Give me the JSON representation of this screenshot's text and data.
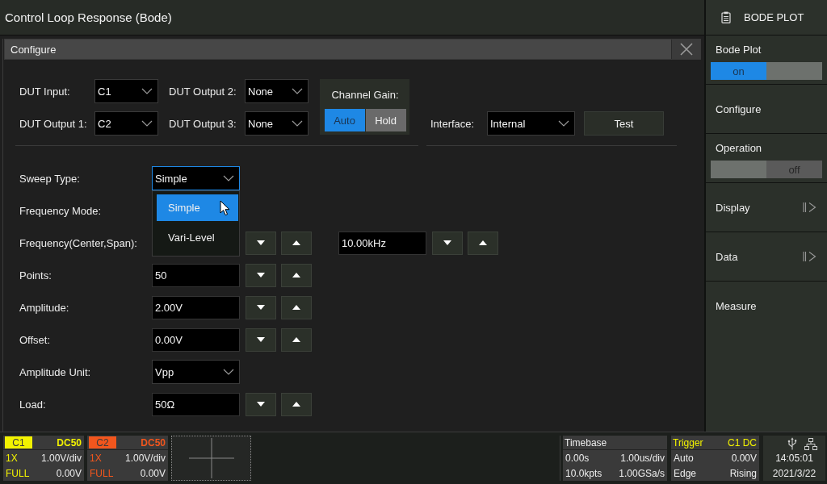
{
  "title_bar": {
    "title": "Control Loop Response (Bode)"
  },
  "menu_header": {
    "title": "BODE PLOT"
  },
  "dialog": {
    "title": "Configure",
    "dut": [
      {
        "label": "DUT Input:",
        "value": "C1"
      },
      {
        "label": "DUT Output 2:",
        "value": "None"
      },
      {
        "label": "DUT Output 1:",
        "value": "C2"
      },
      {
        "label": "DUT Output 3:",
        "value": "None"
      }
    ],
    "channel_gain": {
      "label": "Channel Gain:",
      "options": [
        {
          "label": "Auto",
          "selected": true
        },
        {
          "label": "Hold",
          "selected": false
        }
      ]
    },
    "interface": {
      "label": "Interface:",
      "value": "Internal"
    },
    "test_button": "Test",
    "settings": [
      {
        "label": "Sweep Type:",
        "kind": "select",
        "value": "Simple",
        "focused": true,
        "options": [
          {
            "label": "Simple",
            "selected": true
          },
          {
            "label": "Vari-Level",
            "selected": false
          }
        ]
      },
      {
        "label": "Frequency Mode:",
        "kind": "label"
      },
      {
        "label": "Frequency(Center,Span):",
        "kind": "span",
        "fields": [
          {
            "value": "10.00kHz"
          }
        ]
      },
      {
        "label": "Points:",
        "kind": "number",
        "fields": [
          {
            "value": "50"
          }
        ]
      },
      {
        "label": "Amplitude:",
        "kind": "number",
        "fields": [
          {
            "value": "2.00V"
          }
        ]
      },
      {
        "label": "Offset:",
        "kind": "number",
        "fields": [
          {
            "value": "0.00V"
          }
        ]
      },
      {
        "label": "Amplitude Unit:",
        "kind": "select",
        "value": "Vpp",
        "focused": false
      },
      {
        "label": "Load:",
        "kind": "number",
        "fields": [
          {
            "value": "50Ω"
          }
        ]
      }
    ]
  },
  "side_menu": [
    {
      "label": "Bode Plot",
      "kind": "toggle",
      "value": "on",
      "on": true
    },
    {
      "label": "Configure",
      "kind": "item"
    },
    {
      "label": "Operation",
      "kind": "toggle",
      "value": "off",
      "on": false
    },
    {
      "label": "Display",
      "kind": "submenu"
    },
    {
      "label": "Data",
      "kind": "submenu"
    },
    {
      "label": "Measure",
      "kind": "item"
    }
  ],
  "status_bar": {
    "channels": [
      {
        "name": "C1",
        "coupling": "DC50",
        "probe": "1X",
        "scale": "1.00V/div",
        "bandwidth": "FULL",
        "offset": "0.00V",
        "color": "#f2f200"
      },
      {
        "name": "C2",
        "coupling": "DC50",
        "probe": "1X",
        "scale": "1.00V/div",
        "bandwidth": "FULL",
        "offset": "0.00V",
        "color": "#f2561d"
      }
    ],
    "timebase": {
      "title": "Timebase",
      "delay": "0.00s",
      "scale": "1.00us/div",
      "memory": "10.0kpts",
      "sample_rate": "1.00GSa/s"
    },
    "trigger": {
      "title": "Trigger",
      "source": "C1 DC",
      "mode": "Auto",
      "trigger_level": "0.00V",
      "type": "Edge",
      "slope": "Rising"
    },
    "clock": {
      "time": "14:05:01",
      "date": "2021/3/22"
    }
  }
}
